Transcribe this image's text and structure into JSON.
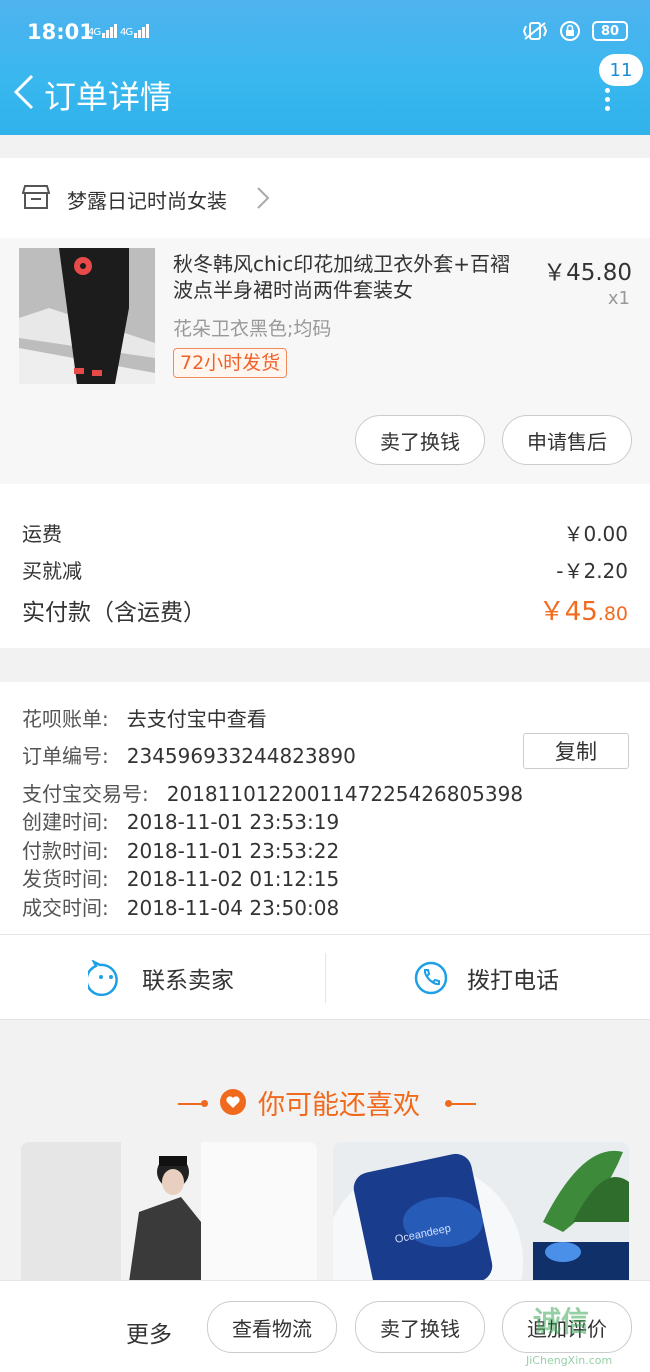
{
  "status_bar": {
    "time": "18:01",
    "signal_1": "4G",
    "signal_2": "4G",
    "battery": "80"
  },
  "nav": {
    "title": "订单详情",
    "badge_count": "11"
  },
  "shop": {
    "name": "梦露日记时尚女装"
  },
  "product": {
    "title": "秋冬韩风chic印花加绒卫衣外套+百褶波点半身裙时尚两件套装女",
    "price": "￥45.80",
    "quantity": "x1",
    "spec": "花朵卫衣黑色;均码",
    "tag": "72小时发货",
    "btn_exchange": "卖了换钱",
    "btn_aftersale": "申请售后"
  },
  "summary": {
    "shipping_label": "运费",
    "shipping_value": "￥0.00",
    "discount_label": "买就减",
    "discount_value": "-￥2.20",
    "total_label": "实付款（含运费）",
    "total_value_main": "￥45",
    "total_value_decimal": ".80"
  },
  "order_info": {
    "huabei_label": "花呗账单:",
    "huabei_value": "去支付宝中查看",
    "order_no_label": "订单编号:",
    "order_no_value": "234596933244823890",
    "copy_label": "复制",
    "alipay_no_label": "支付宝交易号:",
    "alipay_no_value": "2018110122001147225426805398",
    "created_label": "创建时间:",
    "created_value": "2018-11-01 23:53:19",
    "paid_label": "付款时间:",
    "paid_value": "2018-11-01 23:53:22",
    "shipped_label": "发货时间:",
    "shipped_value": "2018-11-02 01:12:15",
    "closed_label": "成交时间:",
    "closed_value": "2018-11-04 23:50:08"
  },
  "contact": {
    "seller_label": "联系卖家",
    "phone_label": "拨打电话"
  },
  "recommend": {
    "title": "你可能还喜欢",
    "card2_text": "Oceandeep"
  },
  "bottom_bar": {
    "more": "更多",
    "logistics": "查看物流",
    "exchange": "卖了换钱",
    "review": "追加评价"
  },
  "watermark": {
    "text": "诚信",
    "sub": "JiChengXin.com"
  },
  "colors": {
    "header": "#39b7ef",
    "accent_orange": "#f36a1e",
    "contact_icon": "#1ea0e6"
  }
}
